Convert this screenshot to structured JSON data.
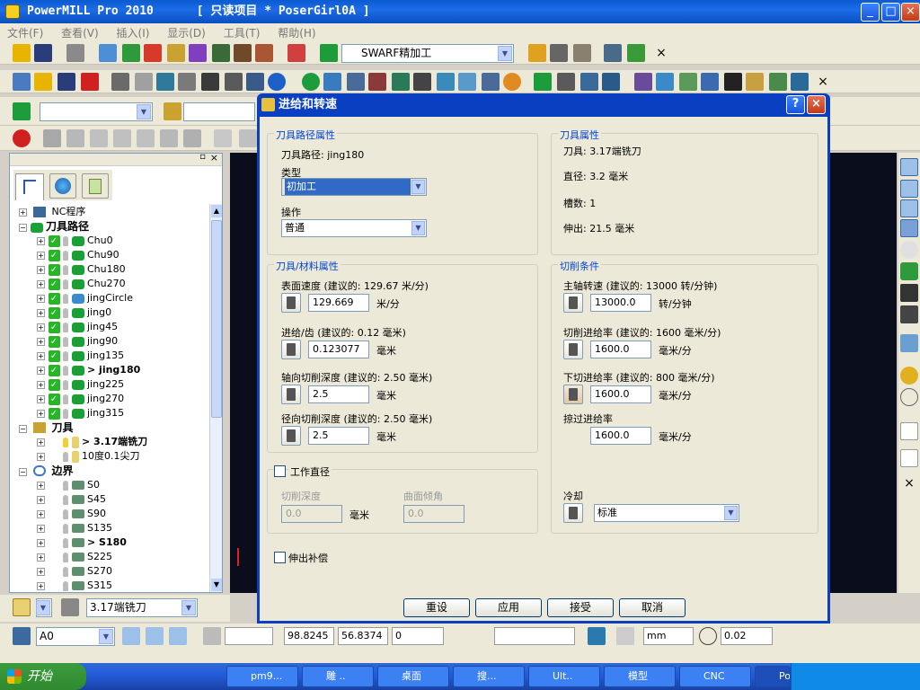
{
  "window": {
    "title": "PowerMILL Pro 2010",
    "project": "[ 只读项目 * PoserGirl0A ]"
  },
  "menu": [
    "文件(F)",
    "查看(V)",
    "插入(I)",
    "显示(D)",
    "工具(T)",
    "帮助(H)"
  ],
  "toolbar": {
    "strategy_combo": "SWARF精加工"
  },
  "tree": {
    "root": "NC程序",
    "toolpaths_label": "刀具路径",
    "toolpaths": [
      "Chu0",
      "Chu90",
      "Chu180",
      "Chu270",
      "jingCircle",
      "jing0",
      "jing45",
      "jing90",
      "jing135",
      "> jing180",
      "jing225",
      "jing270",
      "jing315"
    ],
    "tools_label": "刀具",
    "tools": [
      "> 3.17端铣刀",
      "10度0.1尖刀"
    ],
    "boundaries_label": "边界",
    "boundaries": [
      "S0",
      "S45",
      "S90",
      "S135",
      "> S180",
      "S225",
      "S270",
      "S315"
    ]
  },
  "bottom_tool": {
    "tool_select": "3.17端铣刀"
  },
  "dialog": {
    "title": "进给和转速",
    "toolpath_props": {
      "group": "刀具路径属性",
      "toolpath": "刀具路径: jing180",
      "type_label": "类型",
      "type_value": "初加工",
      "op_label": "操作",
      "op_value": "普通"
    },
    "tool_props": {
      "group": "刀具属性",
      "tool": "刀具: 3.17端铣刀",
      "diameter": "直径: 3.2 毫米",
      "flutes": "槽数: 1",
      "overhang": "伸出: 21.5 毫米"
    },
    "material": {
      "group": "刀具/材料属性",
      "surface_speed_label": "表面速度 (建议的: 129.67 米/分)",
      "surface_speed_value": "129.669",
      "surface_speed_unit": "米/分",
      "feed_tooth_label": "进给/齿 (建议的: 0.12 毫米)",
      "feed_tooth_value": "0.123077",
      "feed_tooth_unit": "毫米",
      "axial_label": "轴向切削深度 (建议的: 2.50 毫米)",
      "axial_value": "2.5",
      "axial_unit": "毫米",
      "radial_label": "径向切削深度 (建议的: 2.50 毫米)",
      "radial_value": "2.5",
      "radial_unit": "毫米"
    },
    "cutting": {
      "group": "切削条件",
      "spindle_label": "主轴转速 (建议的: 13000 转/分钟)",
      "spindle_value": "13000.0",
      "spindle_unit": "转/分钟",
      "cut_feed_label": "切削进给率 (建议的: 1600 毫米/分)",
      "cut_feed_value": "1600.0",
      "cut_feed_unit": "毫米/分",
      "plunge_label": "下切进给率 (建议的: 800 毫米/分)",
      "plunge_value": "1600.0",
      "plunge_unit": "毫米/分",
      "skim_label": "掠过进给率",
      "skim_value": "1600.0",
      "skim_unit": "毫米/分",
      "coolant_label": "冷却",
      "coolant_value": "标准"
    },
    "working_dia": {
      "label": "工作直径",
      "depth_label": "切削深度",
      "depth_value": "0.0",
      "depth_unit": "毫米",
      "tilt_label": "曲面倾角",
      "tilt_value": "0.0"
    },
    "overhang_comp": "伸出补偿",
    "buttons": {
      "reset": "重设",
      "apply": "应用",
      "accept": "接受",
      "cancel": "取消"
    }
  },
  "status": {
    "workplane": "A0",
    "x": "98.8245",
    "y": "56.8374",
    "z": "0",
    "unit": "mm",
    "tol": "0.02"
  },
  "taskbar": {
    "start": "开始",
    "tasks": [
      "pm9...",
      "雕 ..",
      "桌面",
      "搜...",
      "Ult..",
      "模型",
      "CNC",
      "Pow..."
    ]
  },
  "colors": {
    "title_blue": "#0a5ad0",
    "dialog_blue": "#0a3fc2",
    "group_label": "#0046d5",
    "selected": "#316ac5",
    "viewport": "#0a0e1c"
  }
}
